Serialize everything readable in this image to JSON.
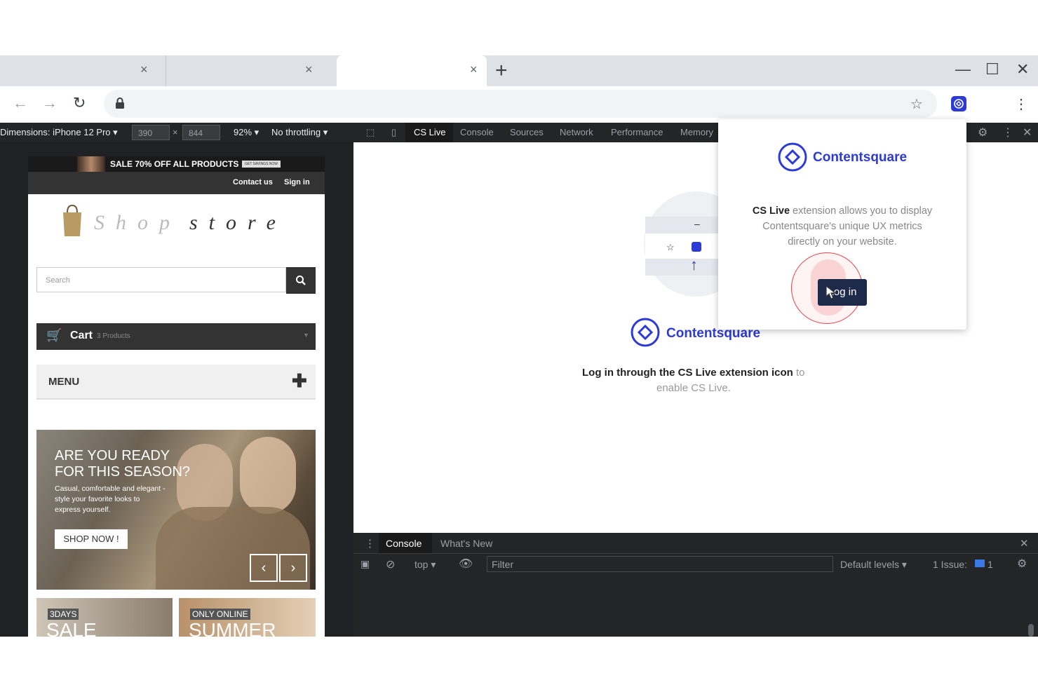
{
  "browser": {
    "tabs": [
      {
        "close_icon": "×"
      },
      {
        "close_icon": "×"
      },
      {
        "close_icon": "×"
      }
    ],
    "new_tab_glyph": "+",
    "window_controls": {
      "minimize": "—",
      "maximize": "☐",
      "close": "✕"
    }
  },
  "device_toolbar": {
    "dimensions_label": "Dimensions: iPhone 12 Pro ▾",
    "width_value": "390",
    "times": "×",
    "height_value": "844",
    "zoom": "92% ▾",
    "throttling": "No throttling ▾"
  },
  "devtools": {
    "tabs": [
      "CS Live",
      "Console",
      "Sources",
      "Network",
      "Performance",
      "Memory"
    ],
    "active_tab": "CS Live",
    "panel": {
      "logo_text": "Contentsquare",
      "instruction_bold": "Log in through the CS Live extension icon",
      "instruction_rest": " to",
      "instruction_line2": "enable CS Live."
    },
    "drawer": {
      "tabs": [
        "Console",
        "What's New"
      ],
      "context": "top ▾",
      "filter_placeholder": "Filter",
      "levels": "Default levels ▾",
      "issues_label": "1 Issue:",
      "issues_count": "1"
    }
  },
  "popup": {
    "logo_text": "Contentsquare",
    "desc_bold": "CS Live",
    "desc_line1": " extension allows you to display",
    "desc_line2": "Contentsquare's unique UX metrics",
    "desc_line3": "directly on your website.",
    "login_label": "Log in"
  },
  "site": {
    "promo": "SALE 70% OFF ALL PRODUCTS",
    "promo_badge": "GET SAVINGS NOW",
    "nav": [
      "Contact us",
      "Sign in"
    ],
    "logo_light": "Shop",
    "logo_dark": "store",
    "search_placeholder": "Search",
    "cart_label": "Cart",
    "cart_count": "3 Products",
    "menu_label": "MENU",
    "hero": {
      "headline1": "ARE YOU READY",
      "headline2": "FOR THIS SEASON?",
      "body1": "Casual, comfortable and elegant -",
      "body2": "style your favorite looks to",
      "body3": "express yourself.",
      "cta": "SHOP NOW !"
    },
    "tile1": {
      "tag": "3DAYS",
      "big": "SALE"
    },
    "tile2": {
      "tag": "ONLY ONLINE",
      "big": "SUMMER"
    }
  },
  "colors": {
    "brand": "#2d3bd6",
    "devtools_bg": "#242526",
    "highlight_ring": "#e8404a"
  }
}
